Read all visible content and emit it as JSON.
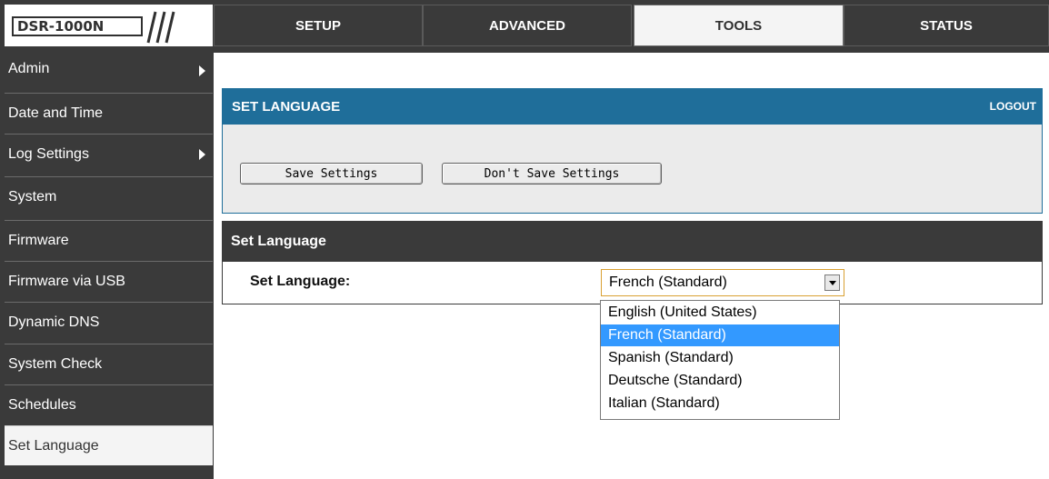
{
  "header": {
    "model": "DSR-1000N",
    "tabs": [
      {
        "label": "SETUP"
      },
      {
        "label": "ADVANCED"
      },
      {
        "label": "TOOLS"
      },
      {
        "label": "STATUS"
      }
    ],
    "active_tab": "TOOLS"
  },
  "sidebar": {
    "items": [
      {
        "label": "Admin"
      },
      {
        "label": "Date and Time"
      },
      {
        "label": "Log Settings"
      },
      {
        "label": "System"
      },
      {
        "label": "Firmware"
      },
      {
        "label": "Firmware via USB"
      },
      {
        "label": "Dynamic DNS"
      },
      {
        "label": "System Check"
      },
      {
        "label": "Schedules"
      },
      {
        "label": "Set Language"
      }
    ],
    "active_item": "Set Language"
  },
  "panel": {
    "title": "SET LANGUAGE",
    "logout": "LOGOUT",
    "save_label": "Save Settings",
    "dont_save_label": "Don't Save Settings"
  },
  "section": {
    "title": "Set Language",
    "field_label": "Set Language:",
    "selected_value": "French (Standard)",
    "options": [
      {
        "label": "English (United States)"
      },
      {
        "label": "French (Standard)"
      },
      {
        "label": "Spanish (Standard)"
      },
      {
        "label": "Deutsche (Standard)"
      },
      {
        "label": "Italian (Standard)"
      }
    ]
  },
  "colors": {
    "topbar": "#3a3a3a",
    "panel_header": "#1f6e9a",
    "panel_body": "#ebebeb",
    "dropdown_highlight": "#3399ff",
    "select_border": "#d9a032"
  }
}
